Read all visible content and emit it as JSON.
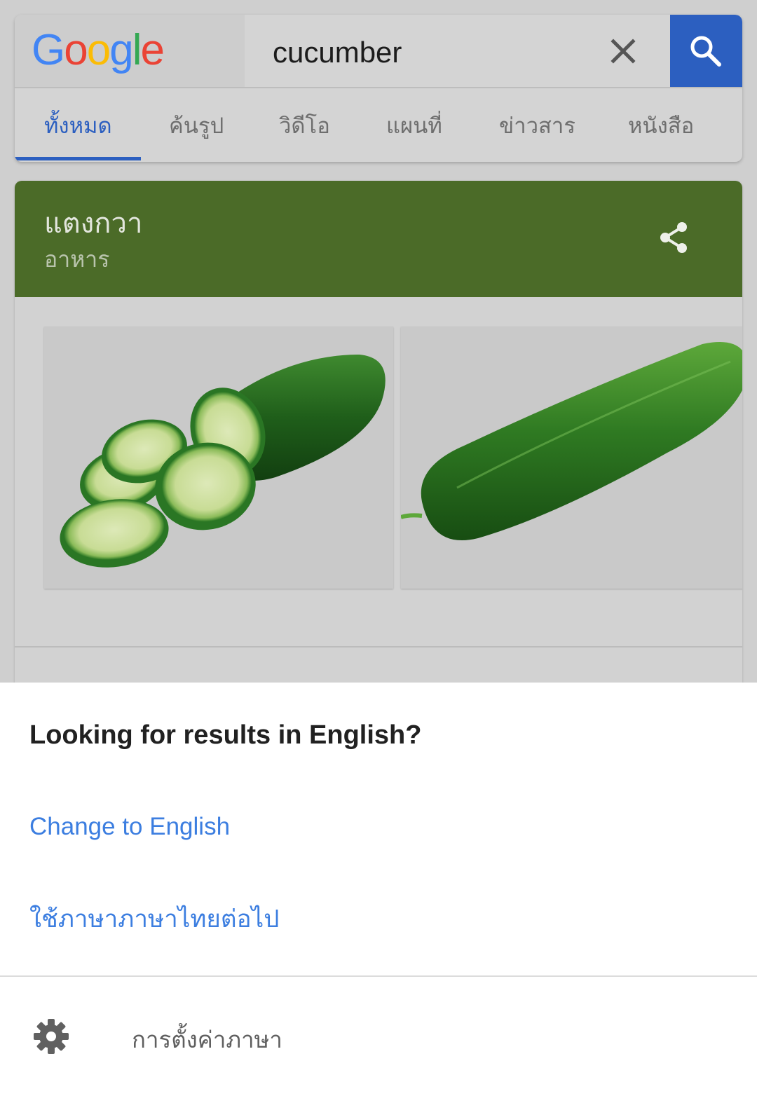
{
  "colors": {
    "accent_blue": "#2c5fc0",
    "link_blue": "#3c7ee0",
    "card_green": "#4b6b28",
    "logo_blue": "#4285f4",
    "logo_red": "#ea4335",
    "logo_yellow": "#fbbc05",
    "logo_green": "#34a853"
  },
  "search": {
    "logo_letters": [
      "G",
      "o",
      "o",
      "g",
      "l",
      "e"
    ],
    "query": "cucumber",
    "clear_icon": "close-icon",
    "search_icon": "search-icon"
  },
  "tabs": [
    {
      "label": "ทั้งหมด",
      "active": true
    },
    {
      "label": "ค้นรูป",
      "active": false
    },
    {
      "label": "วิดีโอ",
      "active": false
    },
    {
      "label": "แผนที่",
      "active": false
    },
    {
      "label": "ข่าวสาร",
      "active": false
    },
    {
      "label": "หนังสือ",
      "active": false
    }
  ],
  "knowledge_card": {
    "title": "แตงกวา",
    "subtitle": "อาหาร",
    "share_icon": "share-icon",
    "images": [
      "sliced-cucumber",
      "whole-cucumber"
    ]
  },
  "language_sheet": {
    "title": "Looking for results in English?",
    "change_link": "Change to English",
    "keep_link": "ใช้ภาษาภาษาไทยต่อไป",
    "settings_icon": "gear-icon",
    "settings_label": "การตั้งค่าภาษา"
  }
}
